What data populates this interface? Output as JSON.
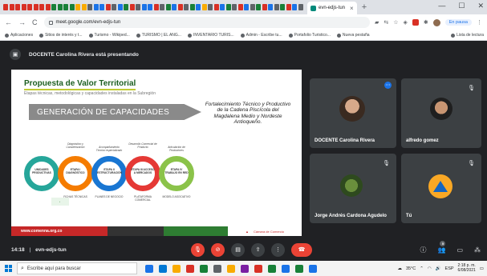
{
  "browser": {
    "active_tab_label": "evn-edjs-tun",
    "tab_close": "×",
    "new_tab": "+",
    "url": "meet.google.com/evn-edjs-tun",
    "pause_label": "En pausa",
    "bookmarks": [
      "Aplicaciones",
      "Sitios de interés y t...",
      "Turismo - Wikiped...",
      "TURISMO | EL ANG...",
      "INVENTARIO TURIS...",
      "Admin - Escribe tu...",
      "Portafolio Turistico...",
      "Nueva pestaña"
    ],
    "reading_list": "Lista de lectura"
  },
  "meet": {
    "presenting_text": "DOCENTE Carolina Rivera está presentando",
    "meeting_time": "14:18",
    "meeting_code": "evn-edjs-tun",
    "participants_count": "5",
    "tiles": [
      {
        "name": "DOCENTE Carolina Rivera"
      },
      {
        "name": "alfredo gomez"
      },
      {
        "name": "Jorge Andrés Cardona Agudelo"
      },
      {
        "name": "Tú"
      }
    ]
  },
  "slide": {
    "title": "Propuesta de Valor Territorial",
    "subtitle": "Etapas técnicas, metodológicas y capacidades instaladas en la Subregión",
    "banner": "GENERACIÓN DE CAPACIDADES",
    "right_text": "Fortalecimiento Técnico y Productivo de la Cadena Piscícola del Magdalena Medio y Nordeste Antioqueño.",
    "rings": [
      {
        "label": "UNIDADES PRODUCTIVAS",
        "color": "#26a69a"
      },
      {
        "label": "ETAPA I DIAGNÓSTICO",
        "color": "#f57c00"
      },
      {
        "label": "ETAPA II ESTRUCTURACIÓN",
        "color": "#1976d2"
      },
      {
        "label": "ETAPA III ACCESO A MERCADOS",
        "color": "#e53935"
      },
      {
        "label": "ETAPA IV TRABAJO EN RED",
        "color": "#8bc34a"
      }
    ],
    "above_labels": [
      "Diagnóstico y Caracterización",
      "Acompañamiento Técnico especializado",
      "Desarrollo Comercial de Producto",
      "Articulación de Productores"
    ],
    "below_labels": [
      "FICHAS TÉCNICAS",
      "PLANES DE NEGOCIO",
      "PLATAFORMA COMERCIAL",
      "MODELO ASOCIATIVO"
    ],
    "footer_url": "www.comenna.org.co",
    "footer_logo": "Cámara de Comercio"
  },
  "taskbar": {
    "search_placeholder": "Escribe aquí para buscar",
    "temperature": "35°C",
    "lang": "ESP",
    "time": "2:18 p. m.",
    "date": "6/08/2021"
  }
}
